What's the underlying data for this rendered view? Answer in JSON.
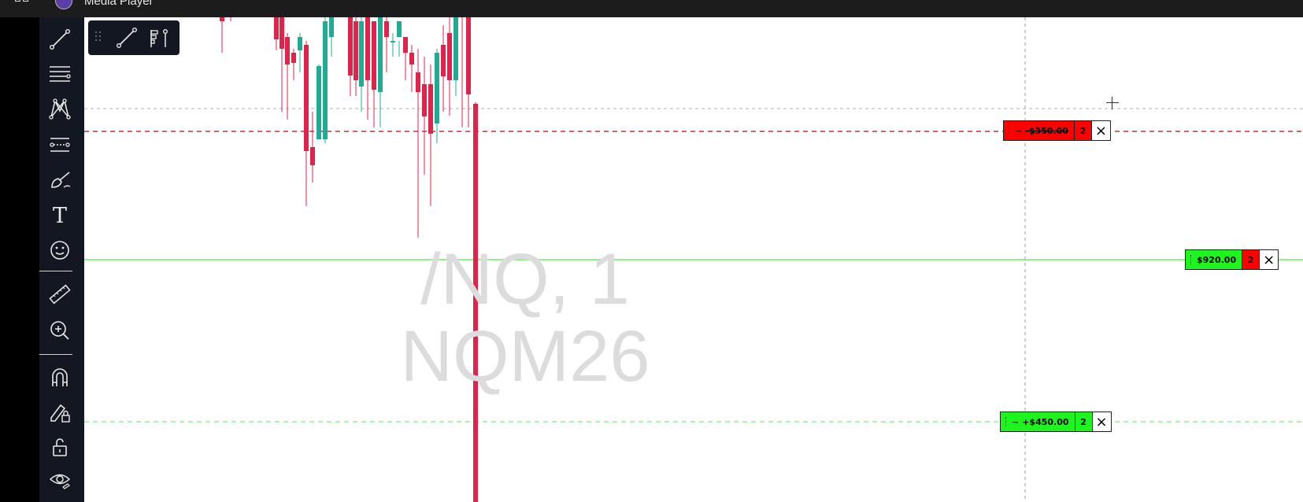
{
  "window": {
    "title": "Media Player"
  },
  "chart": {
    "watermark_line1": "/NQ, 1",
    "watermark_line2": "NQM26",
    "colors": {
      "up": "#22ab94",
      "down": "#e0234a",
      "position_line": "#8ff08f",
      "stop_line": "#c0303f",
      "target_line": "#8ff08f"
    }
  },
  "toolbar": {
    "tools": [
      "trendline-icon",
      "horizontal-lines-icon",
      "pattern-icon",
      "prediction-icon",
      "brush-icon",
      "text-icon",
      "emoji-icon",
      "ruler-icon",
      "zoom-in-icon",
      "magnet-icon",
      "lock-drawing-icon",
      "unlock-icon",
      "eye-icon"
    ],
    "text_tool_label": "T"
  },
  "floating_toolbar": {
    "tools": [
      "drag-handle-icon",
      "trendline-icon",
      "fib-icon"
    ]
  },
  "orders": {
    "stop": {
      "tilde": "~",
      "value": "-$350.00",
      "qty": "2",
      "close": "×"
    },
    "position": {
      "value": "$920.00",
      "qty": "2",
      "close": "×"
    },
    "target": {
      "tilde": "~",
      "value": "+$450.00",
      "qty": "2",
      "close": "×"
    }
  }
}
